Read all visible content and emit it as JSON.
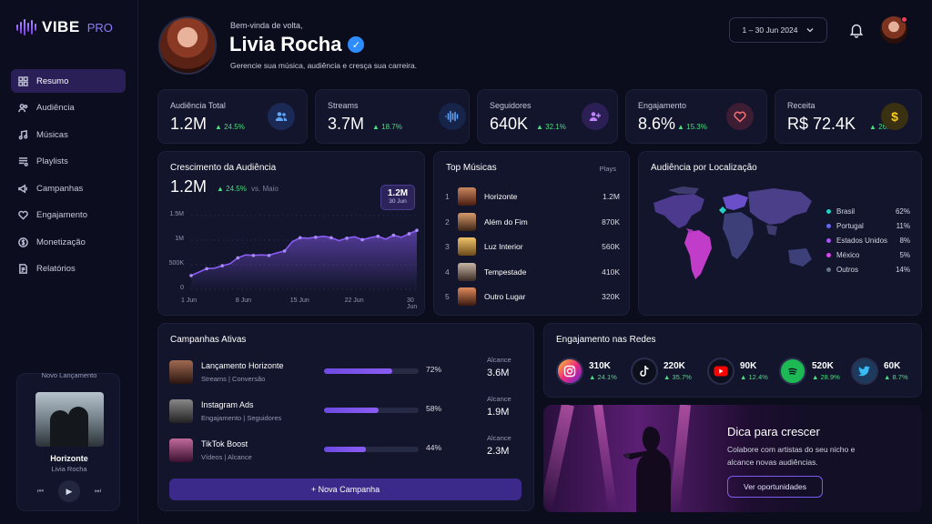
{
  "brand": {
    "name": "VIBE",
    "suffix": "PRO"
  },
  "nav": [
    {
      "label": "Resumo",
      "icon": "grid-icon",
      "active": true
    },
    {
      "label": "Audiência",
      "icon": "users-icon"
    },
    {
      "label": "Músicas",
      "icon": "music-note-icon"
    },
    {
      "label": "Playlists",
      "icon": "playlist-icon"
    },
    {
      "label": "Campanhas",
      "icon": "megaphone-icon"
    },
    {
      "label": "Engajamento",
      "icon": "heart-icon"
    },
    {
      "label": "Monetização",
      "icon": "dollar-icon"
    },
    {
      "label": "Relatórios",
      "icon": "report-icon"
    }
  ],
  "release": {
    "label": "Novo Lançamento",
    "title": "Horizonte",
    "artist": "Livia Rocha"
  },
  "header": {
    "welcome": "Bem-vinda de volta,",
    "name": "Livia Rocha",
    "subtitle": "Gerencie sua música, audiência e cresça sua carreira.",
    "date_range": "1 – 30 Jun 2024"
  },
  "stats": [
    {
      "label": "Audiência Total",
      "value": "1.2M",
      "change": "24.5%",
      "icon": "users-icon",
      "color": "#3b82f6"
    },
    {
      "label": "Streams",
      "value": "3.7M",
      "change": "18.7%",
      "icon": "soundwave-icon",
      "color": "#3b82f6"
    },
    {
      "label": "Seguidores",
      "value": "640K",
      "change": "32.1%",
      "icon": "user-plus-icon",
      "color": "#a855f7"
    },
    {
      "label": "Engajamento",
      "value": "8.6%",
      "change": "15.3%",
      "icon": "heart-icon",
      "color": "#ef4444"
    },
    {
      "label": "Receita",
      "value": "R$ 72.4K",
      "change": "26.8%",
      "icon": "dollar-icon",
      "color": "#eab308"
    }
  ],
  "growth": {
    "title": "Crescimento da Audiência",
    "value": "1.2M",
    "change": "24.5%",
    "vs": "vs. Maio",
    "tooltip_value": "1.2M",
    "tooltip_date": "30 Jun"
  },
  "chart_data": {
    "type": "area",
    "title": "Crescimento da Audiência",
    "x": [
      1,
      2,
      3,
      4,
      5,
      6,
      7,
      8,
      9,
      10,
      11,
      12,
      13,
      14,
      15,
      16,
      17,
      18,
      19,
      20,
      21,
      22,
      23,
      24,
      25,
      26,
      27,
      28,
      29,
      30
    ],
    "values": [
      280000,
      350000,
      420000,
      430000,
      480000,
      520000,
      640000,
      700000,
      690000,
      700000,
      690000,
      740000,
      780000,
      970000,
      1050000,
      1040000,
      1060000,
      1080000,
      1050000,
      990000,
      1040000,
      1070000,
      1010000,
      1050000,
      1080000,
      1020000,
      1100000,
      1060000,
      1130000,
      1200000
    ],
    "xticks": [
      "1 Jun",
      "8 Jun",
      "15 Jun",
      "22 Jun",
      "30 Jun"
    ],
    "xtick_days": [
      1,
      8,
      15,
      22,
      30
    ],
    "yticks": [
      "0",
      "500K",
      "1M",
      "1.5M"
    ],
    "ytick_values": [
      0,
      500000,
      1000000,
      1500000
    ],
    "ylim": [
      0,
      1500000
    ],
    "color": "#8b5cf6",
    "grid": true
  },
  "top_songs": {
    "title": "Top Músicas",
    "col": "Plays",
    "items": [
      {
        "rank": "1",
        "title": "Horizonte",
        "plays": "1.2M"
      },
      {
        "rank": "2",
        "title": "Além do Fim",
        "plays": "870K"
      },
      {
        "rank": "3",
        "title": "Luz Interior",
        "plays": "560K"
      },
      {
        "rank": "4",
        "title": "Tempestade",
        "plays": "410K"
      },
      {
        "rank": "5",
        "title": "Outro Lugar",
        "plays": "320K"
      }
    ]
  },
  "location": {
    "title": "Audiência por Localização",
    "items": [
      {
        "name": "Brasil",
        "pct": "62%",
        "color": "#22d3c5"
      },
      {
        "name": "Portugal",
        "pct": "11%",
        "color": "#6366f1"
      },
      {
        "name": "Estados Unidos",
        "pct": "8%",
        "color": "#a855f7"
      },
      {
        "name": "México",
        "pct": "5%",
        "color": "#d946ef"
      },
      {
        "name": "Outros",
        "pct": "14%",
        "color": "#64748b"
      }
    ]
  },
  "campaigns": {
    "title": "Campanhas Ativas",
    "reach_label": "Alcance",
    "items": [
      {
        "name": "Lançamento Horizonte",
        "sub": "Streams | Conversão",
        "pct": "72%",
        "progress": 0.72,
        "reach": "3.6M"
      },
      {
        "name": "Instagram Ads",
        "sub": "Engajamento | Seguidores",
        "pct": "58%",
        "progress": 0.58,
        "reach": "1.9M"
      },
      {
        "name": "TikTok Boost",
        "sub": "Vídeos | Alcance",
        "pct": "44%",
        "progress": 0.44,
        "reach": "2.3M"
      }
    ],
    "new_button": "+ Nova Campanha"
  },
  "social": {
    "title": "Engajamento nas Redes",
    "items": [
      {
        "network": "instagram-icon",
        "value": "310K",
        "change": "24.1%"
      },
      {
        "network": "tiktok-icon",
        "value": "220K",
        "change": "35.7%"
      },
      {
        "network": "youtube-icon",
        "value": "90K",
        "change": "12.4%"
      },
      {
        "network": "spotify-icon",
        "value": "520K",
        "change": "28.9%"
      },
      {
        "network": "twitter-icon",
        "value": "60K",
        "change": "8.7%"
      }
    ]
  },
  "tip": {
    "title": "Dica para crescer",
    "text": "Colabore com artistas do seu nicho e alcance novas audiências.",
    "button": "Ver oportunidades"
  }
}
